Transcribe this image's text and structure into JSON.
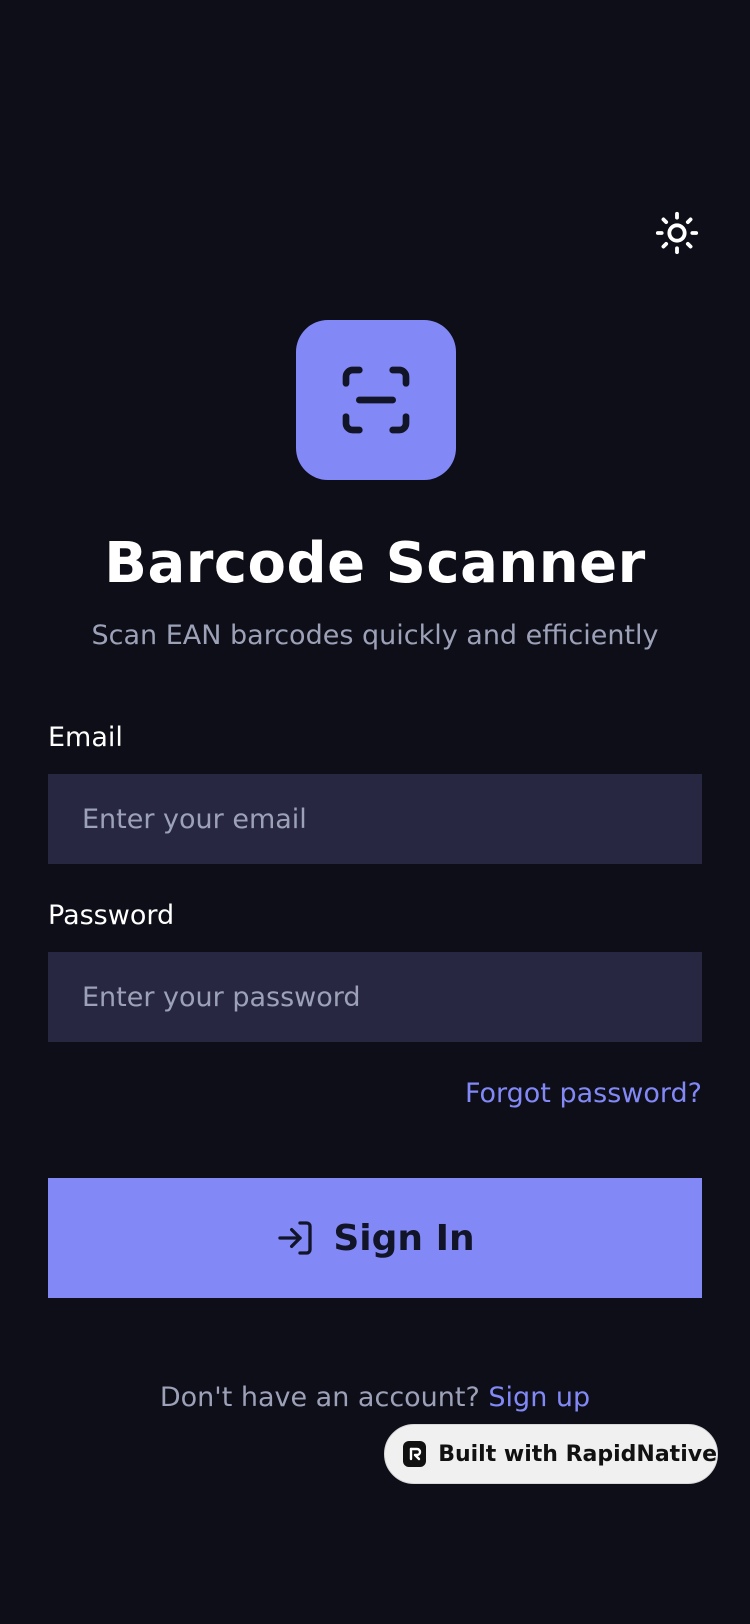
{
  "header": {
    "theme_toggle_icon": "sun-icon"
  },
  "brand": {
    "logo_icon": "scan-icon",
    "title": "Barcode Scanner",
    "subtitle": "Scan EAN barcodes quickly and efficiently"
  },
  "form": {
    "email": {
      "label": "Email",
      "placeholder": "Enter your email",
      "value": ""
    },
    "password": {
      "label": "Password",
      "placeholder": "Enter your password",
      "value": ""
    },
    "forgot_label": "Forgot password?",
    "signin_label": "Sign In",
    "signin_icon": "log-in-icon"
  },
  "footer": {
    "prompt": "Don't have an account?",
    "signup_label": "Sign up"
  },
  "badge": {
    "label": "Built with RapidNative",
    "icon": "rapidnative-logo-icon"
  },
  "colors": {
    "background": "#0e0e18",
    "accent": "#8289f7",
    "input_bg": "#272742",
    "muted_text": "#9ca1b8"
  }
}
